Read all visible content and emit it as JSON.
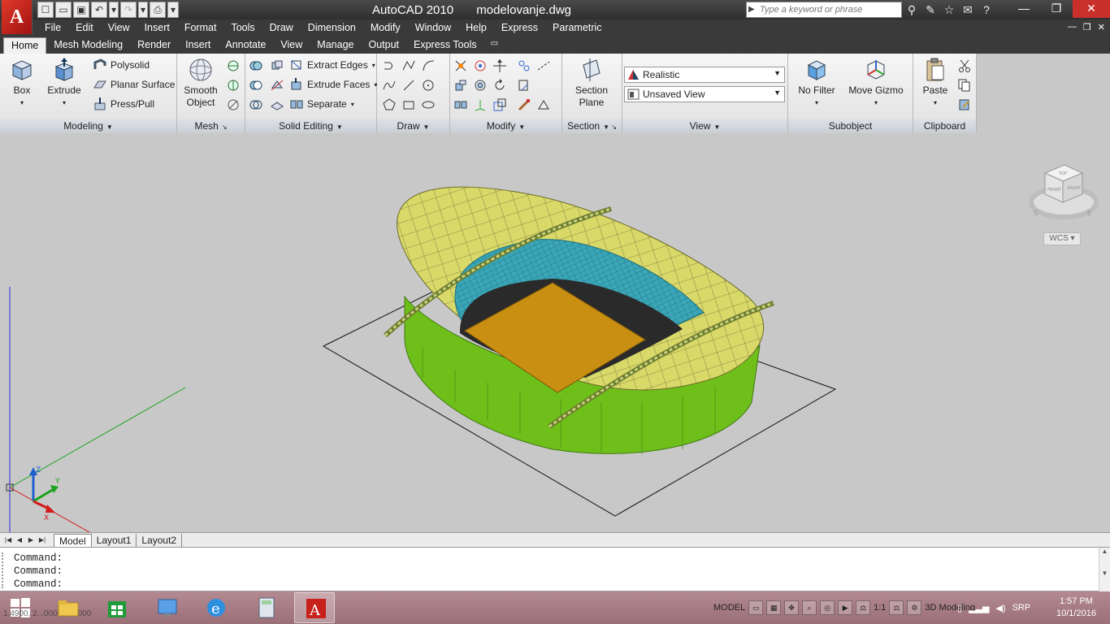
{
  "title_bar": {
    "app_name": "AutoCAD 2010",
    "file_name": "modelovanje.dwg",
    "search_placeholder": "Type a keyword or phrase"
  },
  "menu_bar": {
    "items": [
      "File",
      "Edit",
      "View",
      "Insert",
      "Format",
      "Tools",
      "Draw",
      "Dimension",
      "Modify",
      "Window",
      "Help",
      "Express",
      "Parametric"
    ]
  },
  "ribbon_tabs": [
    "Home",
    "Mesh Modeling",
    "Render",
    "Insert",
    "Annotate",
    "View",
    "Manage",
    "Output",
    "Express Tools"
  ],
  "ribbon": {
    "modeling": {
      "title": "Modeling",
      "box": "Box",
      "extrude": "Extrude",
      "polysolid": "Polysolid",
      "planar_surface": "Planar Surface",
      "press_pull": "Press/Pull"
    },
    "mesh": {
      "title": "Mesh",
      "smooth_object_1": "Smooth",
      "smooth_object_2": "Object"
    },
    "solid_editing": {
      "title": "Solid Editing",
      "extract_edges": "Extract Edges",
      "extrude_faces": "Extrude Faces",
      "separate": "Separate"
    },
    "draw": {
      "title": "Draw"
    },
    "modify": {
      "title": "Modify"
    },
    "section": {
      "title": "Section",
      "plane_1": "Section",
      "plane_2": "Plane"
    },
    "view": {
      "title": "View",
      "visual_style": "Realistic",
      "saved_view": "Unsaved View"
    },
    "subobject": {
      "title": "Subobject",
      "no_filter": "No Filter",
      "move_gizmo": "Move Gizmo"
    },
    "clipboard": {
      "title": "Clipboard",
      "paste": "Paste"
    }
  },
  "viewport": {
    "wcs_label": "WCS",
    "compass": {
      "n": "",
      "s": "S",
      "e": "E"
    },
    "viewcube_faces": {
      "top": "TOP",
      "front": "FRONT",
      "right": "RIGHT"
    },
    "ucs_labels": {
      "x": "X",
      "y": "Y",
      "z": "Z"
    }
  },
  "layout_tabs": [
    "Model",
    "Layout1",
    "Layout2"
  ],
  "command_line": {
    "lines": [
      "Command:",
      "Command:",
      "Command:"
    ],
    "partial": "Command:"
  },
  "status_bar": {
    "coordinates": "1.4900, 2...0000, 0.0000",
    "model_label": "MODEL",
    "scale": "1:1",
    "workspace": "3D Modeling"
  },
  "tray": {
    "language": "SRP",
    "time": "1:57 PM",
    "date": "10/1/2016"
  },
  "colors": {
    "roof": "#d9d96a",
    "wall": "#6fbf1a",
    "field": "#c98f12",
    "seats": "#3aa6b8",
    "pit": "#2a2a2a"
  }
}
